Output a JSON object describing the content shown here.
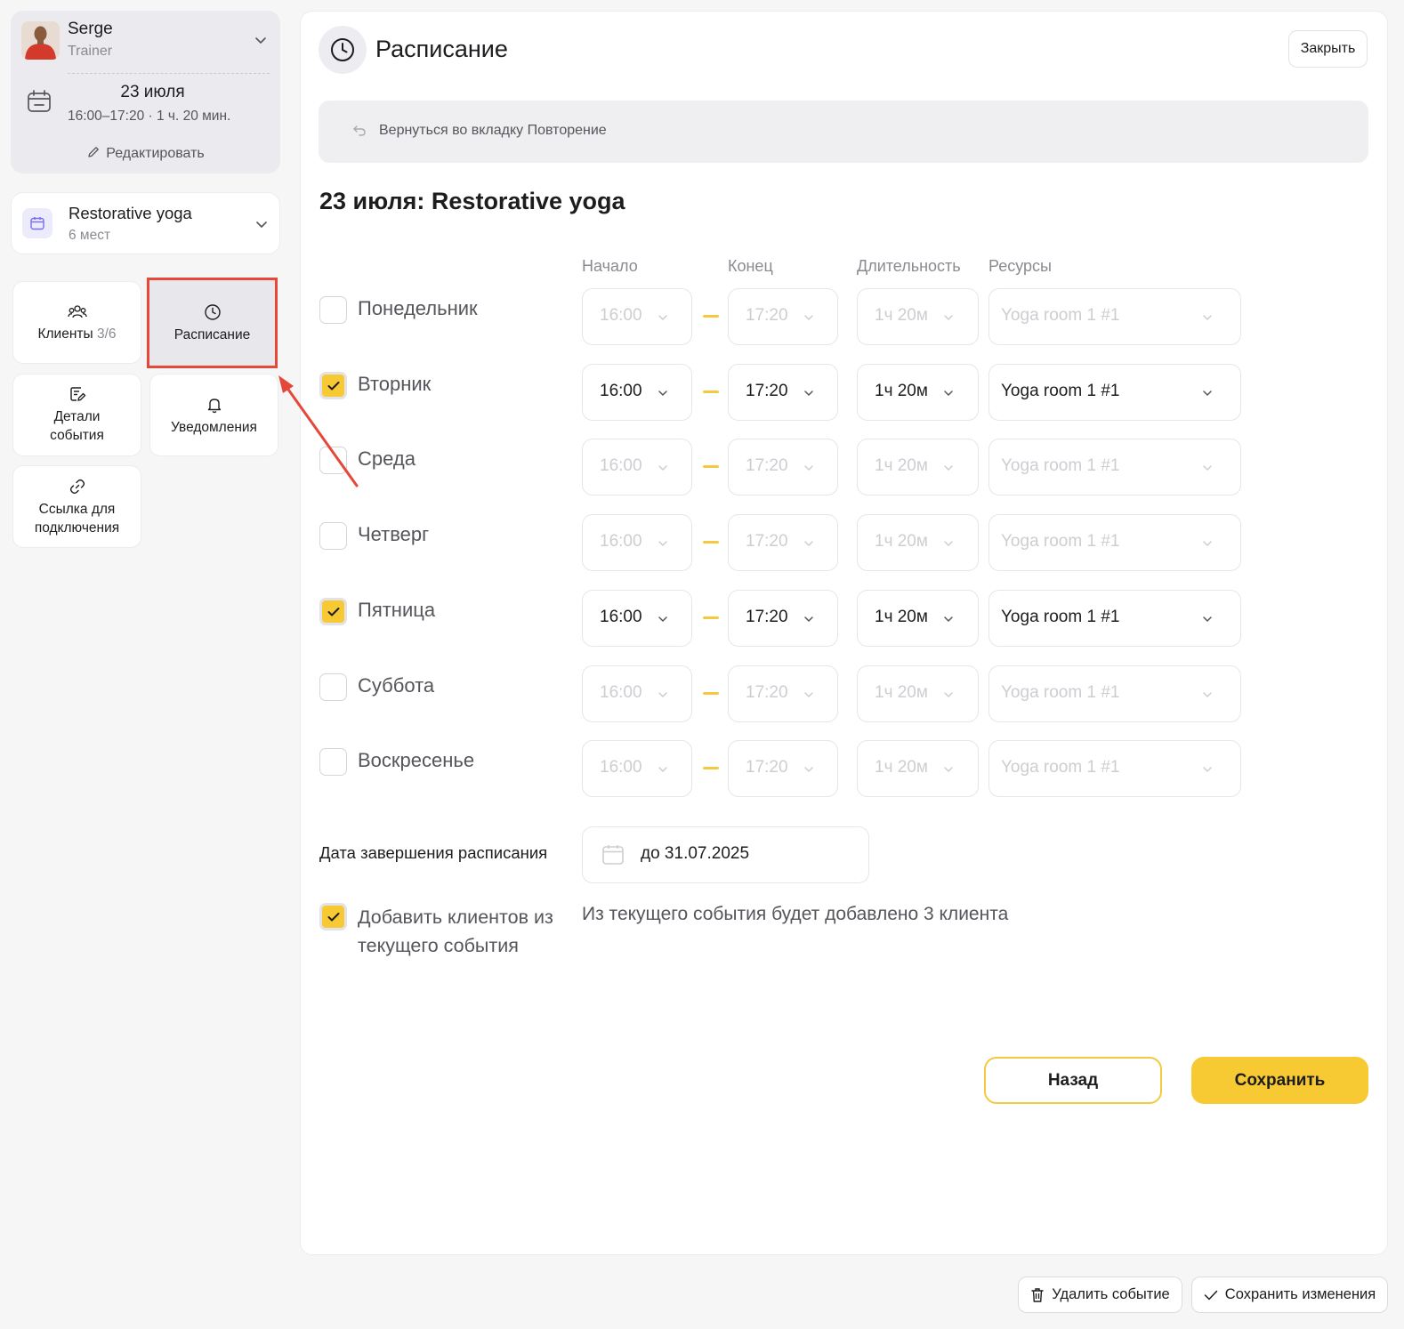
{
  "sidebar": {
    "user": {
      "name": "Serge",
      "role": "Trainer"
    },
    "event": {
      "date": "23 июля",
      "time_range": "16:00–17:20 · 1 ч. 20 мин.",
      "edit_label": "Редактировать"
    },
    "service": {
      "name": "Restorative yoga",
      "places": "6 мест"
    },
    "tiles": {
      "clients_label": "Клиенты",
      "clients_count": "3/6",
      "schedule_label": "Расписание",
      "details_label": "Детали события",
      "notifications_label": "Уведомления",
      "link_label": "Ссылка для подключения"
    }
  },
  "main": {
    "title": "Расписание",
    "close_label": "Закрыть",
    "back_bar_label": "Вернуться во вкладку Повторение",
    "section_title": "23 июля: Restorative yoga",
    "columns": {
      "start": "Начало",
      "end": "Конец",
      "duration": "Длительность",
      "resources": "Ресурсы"
    },
    "days": [
      {
        "name": "Понедельник",
        "checked": false,
        "start": "16:00",
        "end": "17:20",
        "duration": "1ч 20м",
        "resource": "Yoga room 1 #1"
      },
      {
        "name": "Вторник",
        "checked": true,
        "start": "16:00",
        "end": "17:20",
        "duration": "1ч 20м",
        "resource": "Yoga room 1 #1"
      },
      {
        "name": "Среда",
        "checked": false,
        "start": "16:00",
        "end": "17:20",
        "duration": "1ч 20м",
        "resource": "Yoga room 1 #1"
      },
      {
        "name": "Четверг",
        "checked": false,
        "start": "16:00",
        "end": "17:20",
        "duration": "1ч 20м",
        "resource": "Yoga room 1 #1"
      },
      {
        "name": "Пятница",
        "checked": true,
        "start": "16:00",
        "end": "17:20",
        "duration": "1ч 20м",
        "resource": "Yoga room 1 #1"
      },
      {
        "name": "Суббота",
        "checked": false,
        "start": "16:00",
        "end": "17:20",
        "duration": "1ч 20м",
        "resource": "Yoga room 1 #1"
      },
      {
        "name": "Воскресенье",
        "checked": false,
        "start": "16:00",
        "end": "17:20",
        "duration": "1ч 20м",
        "resource": "Yoga room 1 #1"
      }
    ],
    "end_date": {
      "label": "Дата завершения расписания",
      "value": "до 31.07.2025"
    },
    "add_clients": {
      "checked": true,
      "label": "Добавить клиентов из текущего события",
      "note": "Из текущего события будет добавлено 3 клиента"
    },
    "back_button": "Назад",
    "save_button": "Сохранить"
  },
  "footer": {
    "delete_label": "Удалить событие",
    "save_changes_label": "Сохранить изменения"
  },
  "colors": {
    "accent": "#f7c933",
    "highlight": "#e5483a"
  }
}
